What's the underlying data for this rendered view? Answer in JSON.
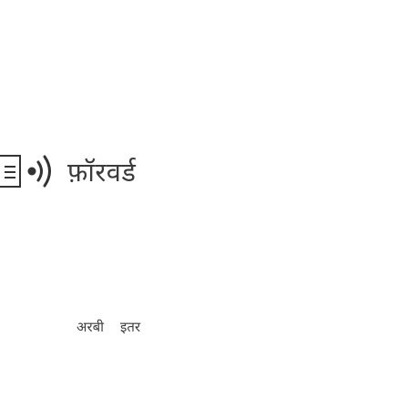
{
  "header": {
    "menu_icon": "hamburger-menu-icon",
    "logo_icon": "sound-waves-icon",
    "brand_name": "फ़ॉरवर्ड"
  },
  "footer": {
    "links": [
      {
        "label": "अरबी"
      },
      {
        "label": "इतर"
      }
    ]
  },
  "colors": {
    "text": "#3f3f3f",
    "border": "#333333",
    "background": "#ffffff"
  }
}
